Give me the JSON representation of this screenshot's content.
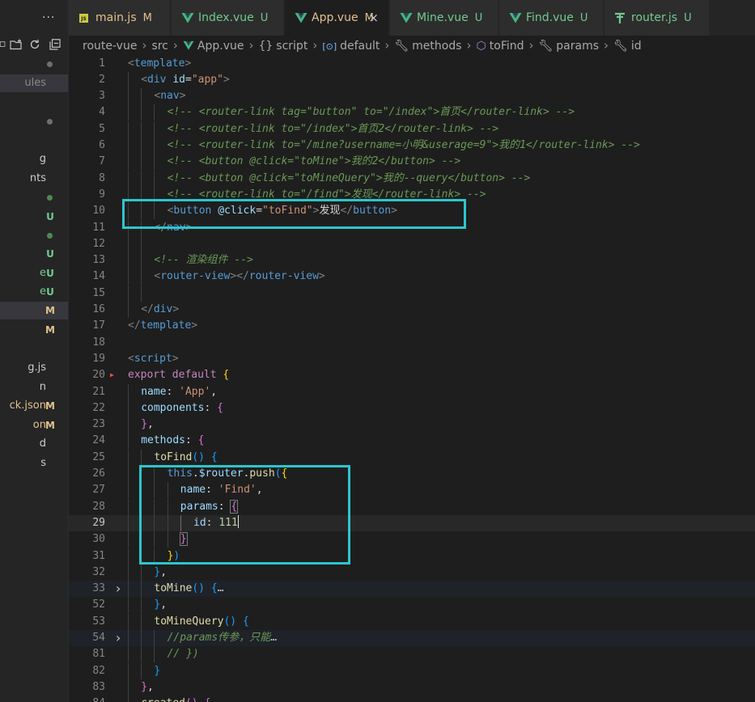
{
  "colors": {
    "annotation_box": "#2cc6cd",
    "modified_badge": "#e2c08d",
    "untracked_badge": "#73c991",
    "vue_icon": "#41b883"
  },
  "sidebar": {
    "more_label": "···",
    "toolbar_icons": [
      "new-file-icon",
      "new-folder-icon",
      "refresh-icon",
      "collapse-all-icon"
    ],
    "rows": [
      {
        "name": "",
        "badge": "",
        "dot": "#6f6f6f",
        "color": "#cccccc"
      },
      {
        "name": "ules",
        "badge": "",
        "dot": "",
        "color": "#8a8a8a",
        "selected": true
      },
      {
        "name": "",
        "badge": "",
        "dot": "",
        "color": "#cccccc"
      },
      {
        "name": "",
        "badge": "",
        "dot": "#6f6f6f",
        "color": "#cccccc"
      },
      {
        "name": "",
        "badge": "",
        "dot": "",
        "color": "#cccccc"
      },
      {
        "name": "g",
        "badge": "",
        "dot": "",
        "color": "#cccccc"
      },
      {
        "name": "nts",
        "badge": "",
        "dot": "",
        "color": "#cccccc"
      },
      {
        "name": "",
        "badge": "",
        "dot": "#4f8a4f",
        "color": "#73c991"
      },
      {
        "name": "",
        "badge": "U",
        "dot": "",
        "color": "#73c991"
      },
      {
        "name": "",
        "badge": "",
        "dot": "#4f8a4f",
        "color": "#73c991"
      },
      {
        "name": "",
        "badge": "U",
        "dot": "",
        "color": "#73c991"
      },
      {
        "name": "e",
        "badge": "U",
        "dot": "",
        "color": "#73c991"
      },
      {
        "name": "e",
        "badge": "U",
        "dot": "",
        "color": "#73c991"
      },
      {
        "name": "",
        "badge": "M",
        "dot": "",
        "color": "#e2c08d",
        "selected": true
      },
      {
        "name": "",
        "badge": "M",
        "dot": "",
        "color": "#e2c08d"
      },
      {
        "name": "",
        "badge": "",
        "dot": "",
        "color": "#cccccc"
      },
      {
        "name": "g.js",
        "badge": "",
        "dot": "",
        "color": "#cccccc"
      },
      {
        "name": "n",
        "badge": "",
        "dot": "",
        "color": "#cccccc"
      },
      {
        "name": "ck.json",
        "badge": "M",
        "dot": "",
        "color": "#e2c08d"
      },
      {
        "name": "on",
        "badge": "M",
        "dot": "",
        "color": "#e2c08d"
      },
      {
        "name": "d",
        "badge": "",
        "dot": "",
        "color": "#cccccc"
      },
      {
        "name": "s",
        "badge": "",
        "dot": "",
        "color": "#cccccc"
      }
    ]
  },
  "tabs": [
    {
      "label": "main.js",
      "status": "M",
      "icon": "js-file-icon",
      "color": "#e2c08d",
      "active": false
    },
    {
      "label": "Index.vue",
      "status": "U",
      "icon": "vue-file-icon",
      "color": "#73c991",
      "active": false
    },
    {
      "label": "App.vue",
      "status": "M",
      "icon": "vue-file-icon",
      "color": "#e2c08d",
      "active": true,
      "close": "×"
    },
    {
      "label": "Mine.vue",
      "status": "U",
      "icon": "vue-file-icon",
      "color": "#73c991",
      "active": false
    },
    {
      "label": "Find.vue",
      "status": "U",
      "icon": "vue-file-icon",
      "color": "#73c991",
      "active": false
    },
    {
      "label": "router.js",
      "status": "U",
      "icon": "router-file-icon",
      "color": "#73c991",
      "active": false
    }
  ],
  "breadcrumb": [
    {
      "label": "route-vue",
      "icon": ""
    },
    {
      "label": "src",
      "icon": ""
    },
    {
      "label": "App.vue",
      "icon": "vue-file-icon"
    },
    {
      "label": "script",
      "icon": "braces-icon"
    },
    {
      "label": "default",
      "icon": "variable-icon"
    },
    {
      "label": "methods",
      "icon": "wrench-icon"
    },
    {
      "label": "toFind",
      "icon": "cube-icon"
    },
    {
      "label": "params",
      "icon": "wrench-icon"
    },
    {
      "label": "id",
      "icon": "wrench-icon"
    }
  ],
  "editor": {
    "active_line": "29",
    "lines": [
      {
        "n": "1",
        "indent": 0,
        "tokens": [
          [
            "<",
            "punct"
          ],
          [
            "template",
            "tag"
          ],
          [
            ">",
            "punct"
          ]
        ]
      },
      {
        "n": "2",
        "indent": 1,
        "tokens": [
          [
            "<",
            "punct"
          ],
          [
            "div",
            "tag"
          ],
          [
            " id",
            "attr"
          ],
          [
            "=",
            "plain"
          ],
          [
            "\"app\"",
            "str"
          ],
          [
            ">",
            "punct"
          ]
        ]
      },
      {
        "n": "3",
        "indent": 2,
        "tokens": [
          [
            "<",
            "punct"
          ],
          [
            "nav",
            "tag"
          ],
          [
            ">",
            "punct"
          ]
        ]
      },
      {
        "n": "4",
        "indent": 3,
        "tokens": [
          [
            "<!-- <router-link tag=\"button\" to=\"/index\">首页</router-link> -->",
            "cmt"
          ]
        ]
      },
      {
        "n": "5",
        "indent": 3,
        "tokens": [
          [
            "<!-- <router-link to=\"/index\">首页2</router-link> -->",
            "cmt"
          ]
        ]
      },
      {
        "n": "6",
        "indent": 3,
        "tokens": [
          [
            "<!-- <router-link to=\"/mine?username=小明&userage=9\">我的1</router-link> -->",
            "cmt"
          ]
        ]
      },
      {
        "n": "7",
        "indent": 3,
        "tokens": [
          [
            "<!-- <button @click=\"toMine\">我的2</button> -->",
            "cmt"
          ]
        ]
      },
      {
        "n": "8",
        "indent": 3,
        "tokens": [
          [
            "<!-- <button @click=\"toMineQuery\">我的--query</button> -->",
            "cmt"
          ]
        ]
      },
      {
        "n": "9",
        "indent": 3,
        "tokens": [
          [
            "<!-- <router-link to=\"/find\">发现</router-link> -->",
            "cmt"
          ]
        ]
      },
      {
        "n": "10",
        "indent": 3,
        "tokens": [
          [
            "<",
            "punct"
          ],
          [
            "button",
            "tag"
          ],
          [
            " @click",
            "attr"
          ],
          [
            "=",
            "plain"
          ],
          [
            "\"toFind\"",
            "str"
          ],
          [
            ">",
            "punct"
          ],
          [
            "发现",
            "plain"
          ],
          [
            "</",
            "punct"
          ],
          [
            "button",
            "tag"
          ],
          [
            ">",
            "punct"
          ]
        ]
      },
      {
        "n": "11",
        "indent": 2,
        "tokens": [
          [
            "</",
            "punct"
          ],
          [
            "nav",
            "tag"
          ],
          [
            ">",
            "punct"
          ]
        ]
      },
      {
        "n": "12",
        "indent": 2,
        "tokens": []
      },
      {
        "n": "13",
        "indent": 2,
        "tokens": [
          [
            "<!-- 渲染组件 -->",
            "cmt"
          ]
        ]
      },
      {
        "n": "14",
        "indent": 2,
        "tokens": [
          [
            "<",
            "punct"
          ],
          [
            "router-view",
            "tag"
          ],
          [
            "></",
            "punct"
          ],
          [
            "router-view",
            "tag"
          ],
          [
            ">",
            "punct"
          ]
        ]
      },
      {
        "n": "15",
        "indent": 2,
        "tokens": []
      },
      {
        "n": "16",
        "indent": 1,
        "tokens": [
          [
            "</",
            "punct"
          ],
          [
            "div",
            "tag"
          ],
          [
            ">",
            "punct"
          ]
        ]
      },
      {
        "n": "17",
        "indent": 0,
        "tokens": [
          [
            "</",
            "punct"
          ],
          [
            "template",
            "tag"
          ],
          [
            ">",
            "punct"
          ]
        ]
      },
      {
        "n": "18",
        "indent": 0,
        "tokens": []
      },
      {
        "n": "19",
        "indent": 0,
        "tokens": [
          [
            "<",
            "punct"
          ],
          [
            "script",
            "tag"
          ],
          [
            ">",
            "punct"
          ]
        ]
      },
      {
        "n": "20",
        "indent": 0,
        "warn": true,
        "tokens": [
          [
            "export",
            "kw"
          ],
          [
            " ",
            "plain"
          ],
          [
            "default",
            "kw"
          ],
          [
            " ",
            "plain"
          ],
          [
            "{",
            "gold"
          ]
        ]
      },
      {
        "n": "21",
        "indent": 1,
        "tokens": [
          [
            "name",
            "attr"
          ],
          [
            ": ",
            "plain"
          ],
          [
            "'App'",
            "str"
          ],
          [
            ",",
            "plain"
          ]
        ]
      },
      {
        "n": "22",
        "indent": 1,
        "tokens": [
          [
            "components",
            "attr"
          ],
          [
            ": ",
            "plain"
          ],
          [
            "{",
            "pink"
          ]
        ]
      },
      {
        "n": "23",
        "indent": 1,
        "tokens": [
          [
            "}",
            "pink"
          ],
          [
            ",",
            "plain"
          ]
        ]
      },
      {
        "n": "24",
        "indent": 1,
        "tokens": [
          [
            "methods",
            "attr"
          ],
          [
            ": ",
            "plain"
          ],
          [
            "{",
            "pink"
          ]
        ]
      },
      {
        "n": "25",
        "indent": 2,
        "tokens": [
          [
            "toFind",
            "fn"
          ],
          [
            "()",
            "blue"
          ],
          [
            " ",
            "plain"
          ],
          [
            "{",
            "blue"
          ]
        ]
      },
      {
        "n": "26",
        "indent": 3,
        "tokens": [
          [
            "this",
            "tag"
          ],
          [
            ".",
            "plain"
          ],
          [
            "$router",
            "attr"
          ],
          [
            ".",
            "plain"
          ],
          [
            "push",
            "fn"
          ],
          [
            "(",
            "blue"
          ],
          [
            "{",
            "gold"
          ]
        ]
      },
      {
        "n": "27",
        "indent": 4,
        "tokens": [
          [
            "name",
            "attr"
          ],
          [
            ": ",
            "plain"
          ],
          [
            "'Find'",
            "str"
          ],
          [
            ",",
            "plain"
          ]
        ]
      },
      {
        "n": "28",
        "indent": 4,
        "tokens": [
          [
            "params",
            "attr"
          ],
          [
            ": ",
            "plain"
          ],
          [
            "{",
            "pink",
            "brk"
          ]
        ]
      },
      {
        "n": "29",
        "indent": 5,
        "cursor": true,
        "tokens": [
          [
            "id",
            "attr"
          ],
          [
            ": ",
            "plain"
          ],
          [
            "111",
            "num"
          ]
        ]
      },
      {
        "n": "30",
        "indent": 4,
        "tokens": [
          [
            "}",
            "pink",
            "brk"
          ]
        ]
      },
      {
        "n": "31",
        "indent": 3,
        "tokens": [
          [
            "}",
            "gold"
          ],
          [
            ")",
            "blue"
          ]
        ]
      },
      {
        "n": "32",
        "indent": 2,
        "tokens": [
          [
            "}",
            "blue"
          ],
          [
            ",",
            "plain"
          ]
        ]
      },
      {
        "n": "33",
        "indent": 2,
        "fold": true,
        "tokens": [
          [
            "toMine",
            "fn"
          ],
          [
            "()",
            "blue"
          ],
          [
            " ",
            "plain"
          ],
          [
            "{",
            "blue"
          ],
          [
            "…",
            "fold"
          ]
        ]
      },
      {
        "n": "52",
        "indent": 2,
        "tokens": [
          [
            "}",
            "blue"
          ],
          [
            ",",
            "plain"
          ]
        ]
      },
      {
        "n": "53",
        "indent": 2,
        "tokens": [
          [
            "toMineQuery",
            "fn"
          ],
          [
            "()",
            "blue"
          ],
          [
            " ",
            "plain"
          ],
          [
            "{",
            "blue"
          ]
        ]
      },
      {
        "n": "54",
        "indent": 3,
        "fold": true,
        "tokens": [
          [
            "//params传参，只能",
            "cmt"
          ],
          [
            "…",
            "fold"
          ]
        ]
      },
      {
        "n": "81",
        "indent": 3,
        "tokens": [
          [
            "// })",
            "cmt"
          ]
        ]
      },
      {
        "n": "82",
        "indent": 2,
        "tokens": [
          [
            "}",
            "blue"
          ]
        ]
      },
      {
        "n": "83",
        "indent": 1,
        "tokens": [
          [
            "}",
            "pink"
          ],
          [
            ",",
            "plain"
          ]
        ]
      },
      {
        "n": "84",
        "indent": 1,
        "tokens": [
          [
            "created",
            "fn"
          ],
          [
            "()",
            "pink"
          ],
          [
            " ",
            "plain"
          ],
          [
            "{",
            "pink"
          ]
        ]
      }
    ]
  }
}
